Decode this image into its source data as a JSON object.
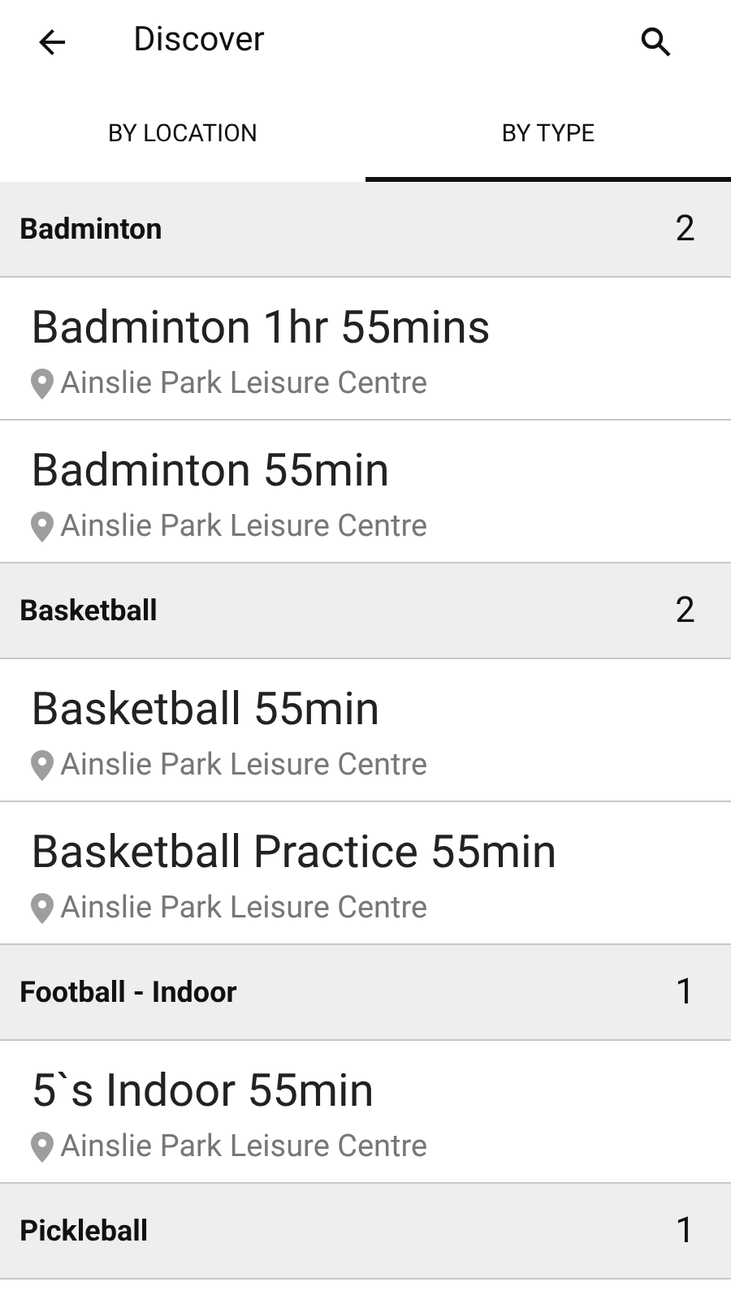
{
  "app_bar": {
    "title": "Discover"
  },
  "tabs": [
    {
      "label": "BY LOCATION",
      "selected": false
    },
    {
      "label": "BY TYPE",
      "selected": true
    }
  ],
  "sections": [
    {
      "title": "Badminton",
      "count": "2",
      "items": [
        {
          "name": "Badminton 1hr 55mins",
          "location": "Ainslie Park Leisure Centre"
        },
        {
          "name": "Badminton 55min",
          "location": "Ainslie Park Leisure Centre"
        }
      ]
    },
    {
      "title": "Basketball",
      "count": "2",
      "items": [
        {
          "name": "Basketball 55min",
          "location": "Ainslie Park Leisure Centre"
        },
        {
          "name": "Basketball Practice 55min",
          "location": "Ainslie Park Leisure Centre"
        }
      ]
    },
    {
      "title": "Football - Indoor",
      "count": "1",
      "items": [
        {
          "name": "5`s Indoor 55min",
          "location": "Ainslie Park Leisure Centre"
        }
      ]
    },
    {
      "title": "Pickleball",
      "count": "1"
    }
  ]
}
